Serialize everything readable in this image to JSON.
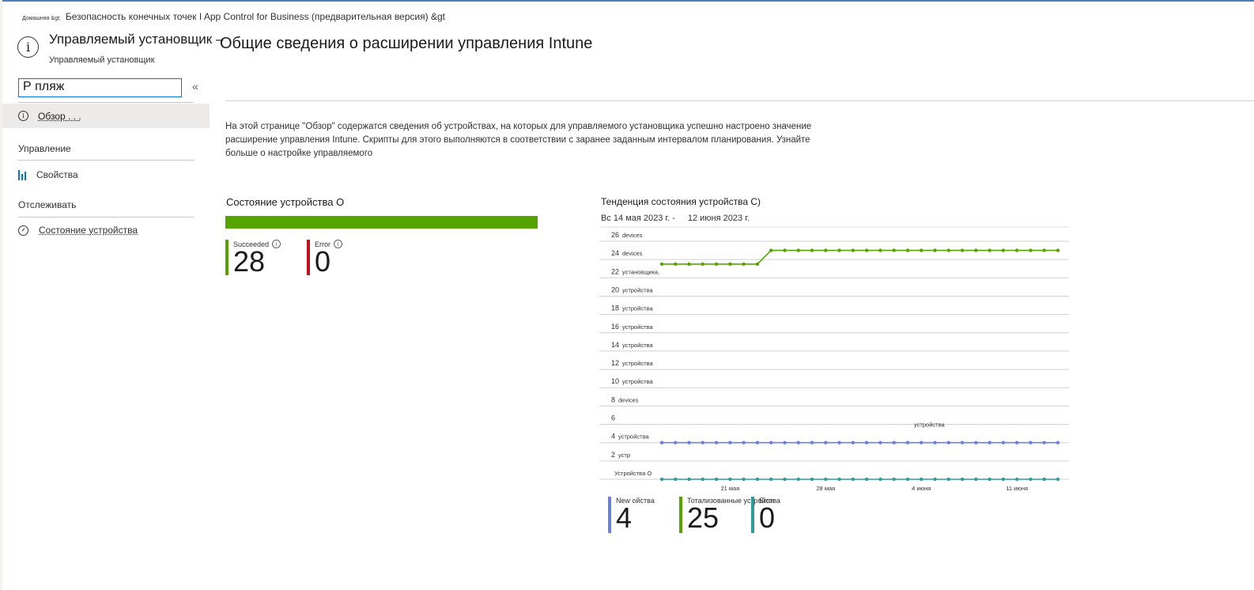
{
  "breadcrumb": {
    "home": "Домашняя &gt;",
    "path": "Безопасность конечных точек I App Control for Business (предварительная версия) &gt"
  },
  "header": {
    "title": "Управляемый установщик –",
    "subtitle": "Управляемый установщик",
    "page_title": "Общие сведения о расширении управления Intune"
  },
  "sidebar": {
    "search_value": "Р пляж",
    "collapse": "«",
    "overview_label": "Обзор . . .",
    "section_manage": "Управление",
    "properties_label": "Свойства",
    "section_monitor": "Отслеживать",
    "device_status_label": "Состояние устройства"
  },
  "description": "На этой странице \"Обзор\" содержатся сведения об устройствах, на которых для управляемого установщика успешно настроено значение расширение управления Intune. Скрипты для этого выполняются в соответствии с заранее заданным интервалом планирования. Узнайте больше о настройке управляемого",
  "device_status": {
    "title": "Состояние устройства О",
    "succeeded_label": "Succeeded",
    "succeeded_value": "28",
    "error_label": "Error",
    "error_value": "0",
    "colors": {
      "success": "#57a300",
      "error": "#c50f1f"
    }
  },
  "trend": {
    "title": "Тенденция состояния устройства С)",
    "range_from": "Вс 14 мая 2023 г. -",
    "range_to": "12 июня 2023 г.",
    "legend": [
      {
        "label": "New ойства",
        "value": "4",
        "color": "#6b7fe0"
      },
      {
        "label": "Тотализованные устройства",
        "value": "25",
        "color": "#57a300"
      },
      {
        "label": "Error",
        "value": "0",
        "color": "#2f9a9a"
      }
    ]
  },
  "chart_data": {
    "type": "line",
    "title": "Тенденция состояния устройства С)",
    "ylim": [
      0,
      26
    ],
    "y_ticks": [
      26,
      24,
      22,
      20,
      18,
      16,
      14,
      12,
      10,
      8,
      6,
      4,
      2,
      0
    ],
    "y_tick_labels": [
      {
        "num": "26",
        "unit": "devices"
      },
      {
        "num": "24",
        "unit": "devices"
      },
      {
        "num": "22",
        "unit": "установщика."
      },
      {
        "num": "20",
        "unit": "устройства"
      },
      {
        "num": "18",
        "unit": "устройства"
      },
      {
        "num": "16",
        "unit": "устройства"
      },
      {
        "num": "14",
        "unit": "устройства"
      },
      {
        "num": "12",
        "unit": "устройства"
      },
      {
        "num": "10",
        "unit": "устройства"
      },
      {
        "num": "8",
        "unit": "devices"
      },
      {
        "num": "6",
        "unit": ""
      },
      {
        "num": "4",
        "unit": "устройства"
      },
      {
        "num": "2",
        "unit": "устр"
      },
      {
        "num": "",
        "unit": "Устройства О"
      }
    ],
    "annotation": "устройства",
    "x_tick_labels": [
      "21 мая",
      "28 мая",
      "4 июня",
      "11 июня"
    ],
    "x_tick_index": [
      5,
      12,
      19,
      26
    ],
    "grid": true,
    "series": [
      {
        "color": "#57a300",
        "values": [
          23.5,
          23.5,
          23.5,
          23.5,
          23.5,
          23.5,
          23.5,
          23.5,
          25,
          25,
          25,
          25,
          25,
          25,
          25,
          25,
          25,
          25,
          25,
          25,
          25,
          25,
          25,
          25,
          25,
          25,
          25,
          25,
          25,
          25
        ]
      },
      {
        "color": "#6b7fe0",
        "values": [
          4,
          4,
          4,
          4,
          4,
          4,
          4,
          4,
          4,
          4,
          4,
          4,
          4,
          4,
          4,
          4,
          4,
          4,
          4,
          4,
          4,
          4,
          4,
          4,
          4,
          4,
          4,
          4,
          4,
          4
        ]
      },
      {
        "color": "#2f9a9a",
        "values": [
          0,
          0,
          0,
          0,
          0,
          0,
          0,
          0,
          0,
          0,
          0,
          0,
          0,
          0,
          0,
          0,
          0,
          0,
          0,
          0,
          0,
          0,
          0,
          0,
          0,
          0,
          0,
          0,
          0,
          0
        ]
      }
    ]
  }
}
